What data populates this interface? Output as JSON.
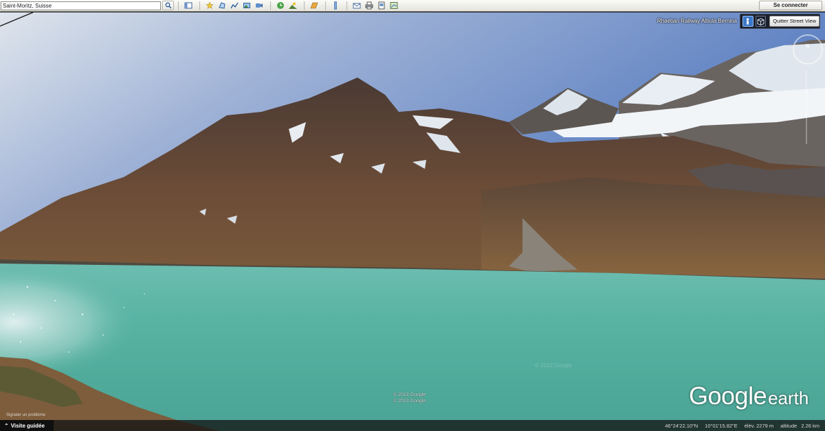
{
  "toolbar": {
    "search_value": "Saint-Moritz, Suisse",
    "search_icon": "magnifier-icon",
    "signin_label": "Se connecter",
    "tools": [
      "sidebar-icon",
      "placemark-icon",
      "polygon-icon",
      "path-icon",
      "image-overlay-icon",
      "record-tour-icon",
      "historical-imagery-icon",
      "sunlight-icon",
      "switch-to-sky-icon",
      "ruler-icon",
      "email-icon",
      "print-icon",
      "save-image-icon",
      "maps-icon"
    ]
  },
  "streetview": {
    "place_label": "Rhaetian Railway Albula Bernina",
    "exit_label": "Quitter Street View",
    "mode_icons": [
      "pegman-icon",
      "cube-icon"
    ],
    "north_label": "N"
  },
  "scene": {
    "copyright_1": "© 2013 Google",
    "copyright_2": "© 2013 Google",
    "watermark": "© 2012 Google",
    "logo_google": "Google",
    "logo_earth": "earth",
    "report_link": "Signaler un problème"
  },
  "tour": {
    "label": "Visite guidée"
  },
  "status": {
    "latitude": "46°24'22.10\"N",
    "longitude": "10°01'15.82\"E",
    "elevation": "élév. 2279 m",
    "altitude_label": "altitude",
    "altitude_value": "2.26 km"
  },
  "colors": {
    "sky_top": "#5a7fc0",
    "lake": "#59b5a4",
    "rock": "#6a4a35"
  }
}
